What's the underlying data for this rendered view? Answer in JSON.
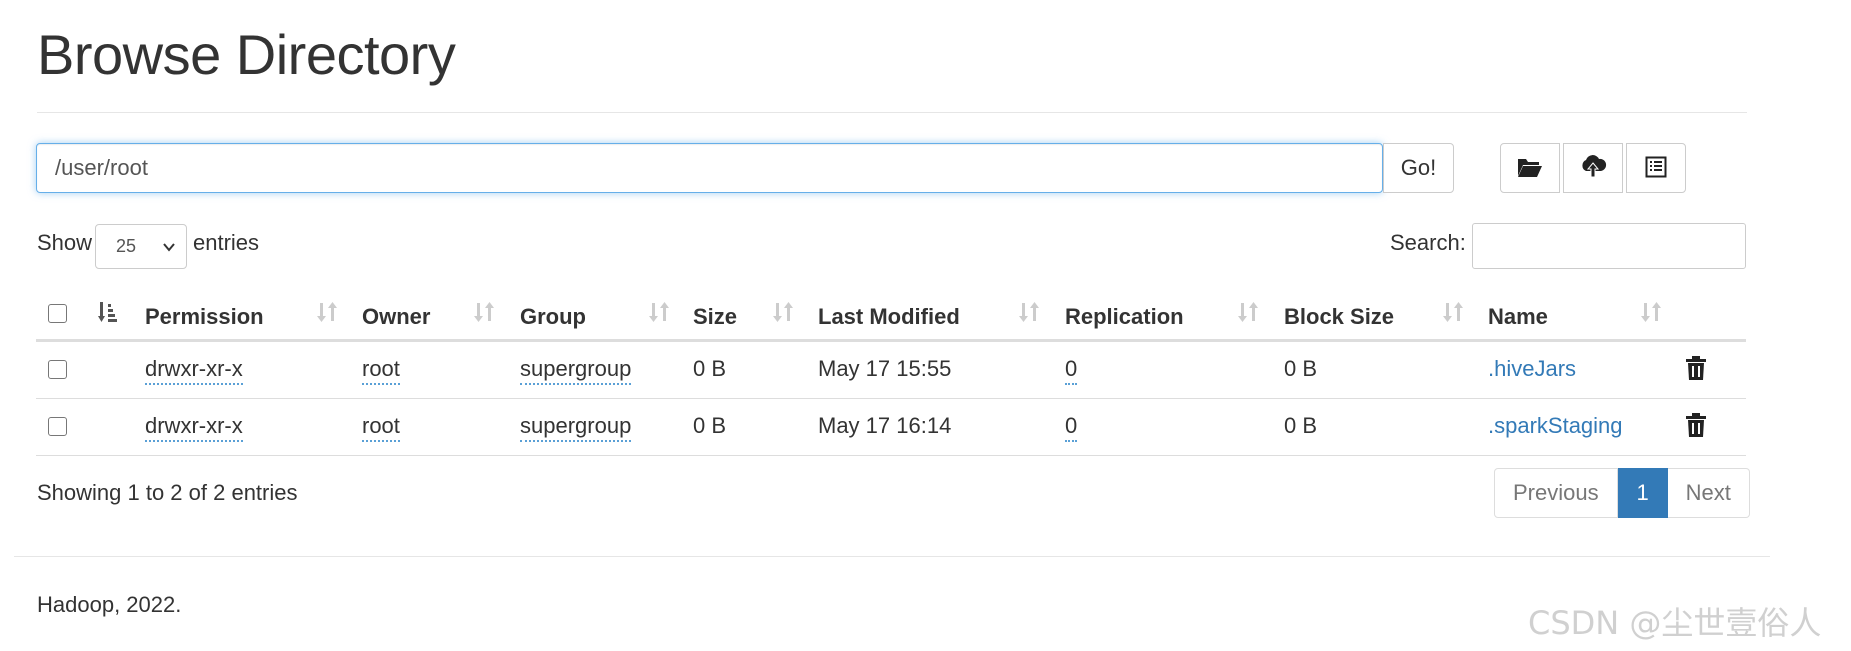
{
  "page": {
    "title": "Browse Directory"
  },
  "path_bar": {
    "value": "/user/root",
    "go_label": "Go!"
  },
  "toolbar": {
    "buttons": [
      {
        "icon": "folder-open-icon"
      },
      {
        "icon": "cloud-upload-icon"
      },
      {
        "icon": "list-alt-icon"
      }
    ]
  },
  "controls": {
    "show_label": "Show",
    "length_value": "25",
    "entries_label": "entries",
    "search_label": "Search:"
  },
  "table": {
    "columns": [
      "Permission",
      "Owner",
      "Group",
      "Size",
      "Last Modified",
      "Replication",
      "Block Size",
      "Name"
    ],
    "rows": [
      {
        "permission": "drwxr-xr-x",
        "owner": "root",
        "group": "supergroup",
        "size": "0 B",
        "last_modified": "May 17 15:55",
        "replication": "0",
        "block_size": "0 B",
        "name": ".hiveJars"
      },
      {
        "permission": "drwxr-xr-x",
        "owner": "root",
        "group": "supergroup",
        "size": "0 B",
        "last_modified": "May 17 16:14",
        "replication": "0",
        "block_size": "0 B",
        "name": ".sparkStaging"
      }
    ]
  },
  "pagination": {
    "info": "Showing 1 to 2 of 2 entries",
    "previous": "Previous",
    "current": "1",
    "next": "Next"
  },
  "footer": {
    "text": "Hadoop, 2022."
  },
  "watermark": {
    "text": "CSDN @尘世壹俗人"
  },
  "colors": {
    "link": "#337ab7",
    "active_page": "#337ab7",
    "focus_border": "#66afe9"
  }
}
